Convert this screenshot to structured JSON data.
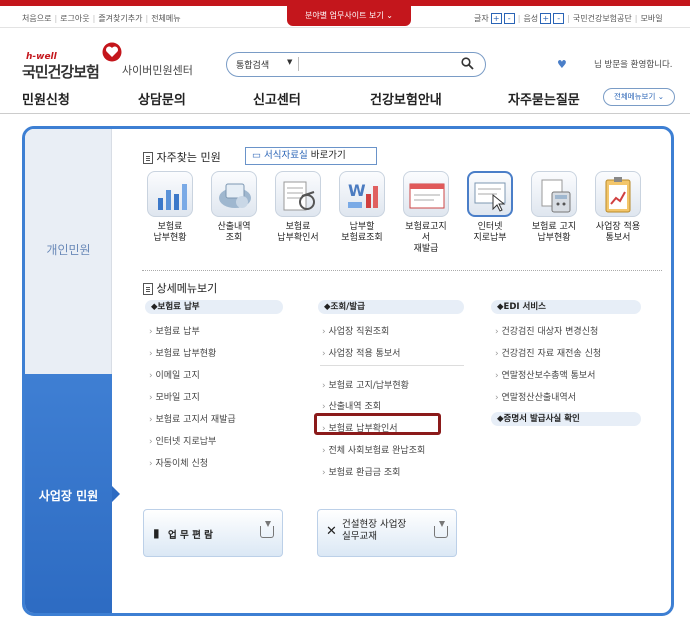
{
  "topbar": {
    "left_links": [
      "처음으로",
      "로그아웃",
      "즐겨찾기추가",
      "전체메뉴"
    ],
    "quick_label": "분야별 업무사이트 보기",
    "font_label": "글자",
    "sound_label": "음성",
    "plus": "+",
    "minus": "-",
    "right_links": [
      "국민건강보험공단",
      "모바일"
    ]
  },
  "header": {
    "hwell": "h-well",
    "brand": "국민건강보험",
    "center": "사이버민원센터",
    "search_select": "통합검색",
    "search_placeholder": "",
    "welcome": "님 방문을 환영합니다."
  },
  "gnb": {
    "items": [
      "민원신청",
      "상담문의",
      "신고센터",
      "건강보험안내",
      "자주묻는질문"
    ],
    "all_menu": "전체메뉴보기"
  },
  "side_tabs": {
    "personal": "개인민원",
    "business": "사업장 민원"
  },
  "favorites": {
    "title": "자주찾는 민원",
    "forms_btn_blue": "서식자료실",
    "forms_btn_dark": " 바로가기",
    "items": [
      {
        "label": "보험료\n납부현황",
        "icon": "chart-icon"
      },
      {
        "label": "산출내역\n조회",
        "icon": "calculator-icon"
      },
      {
        "label": "보험료\n납부확인서",
        "icon": "receipt-icon"
      },
      {
        "label": "납부할\n보험료조회",
        "icon": "won-chart-icon"
      },
      {
        "label": "보험료고지\n서\n재발급",
        "icon": "bill-icon"
      },
      {
        "label": "인터넷\n지로납부",
        "icon": "click-icon"
      },
      {
        "label": "보험료 고지\n납부현황",
        "icon": "calculator-doc-icon"
      },
      {
        "label": "사업장 적용\n통보서",
        "icon": "clipboard-icon"
      }
    ]
  },
  "detail": {
    "title": "상세메뉴보기",
    "col1": {
      "category": "보험료 납부",
      "items": [
        "보험료 납부",
        "보험료 납부현황",
        "이메일 고지",
        "모바일 고지",
        "보험료 고지서 재발급",
        "인터넷 지로납부",
        "자동이체 신청"
      ]
    },
    "col2": {
      "category": "조회/발급",
      "items_a": [
        "사업장 직원조회",
        "사업장 적용 통보서"
      ],
      "items_b": [
        "보험료 고지/납부현황",
        "산출내역 조회",
        "보험료 납부확인서",
        "전체 사회보험료 완납조회",
        "보험료 환급금 조회"
      ]
    },
    "col3": {
      "category": "EDI 서비스",
      "items": [
        "건강검진 대상자 변경신청",
        "건강검진 자료 재전송 신청",
        "연말정산보수총액 통보서",
        "연말정산산출내역서"
      ],
      "category2": "증명서 발급사실 확인"
    }
  },
  "buttons": {
    "manual": "업 무 편 람",
    "construction_line1": "건설현장 사업장",
    "construction_line2": "실무교재"
  },
  "colors": {
    "accent": "#3d7fd3",
    "brand_red": "#c4161c",
    "highlight": "#8b1a1a"
  }
}
